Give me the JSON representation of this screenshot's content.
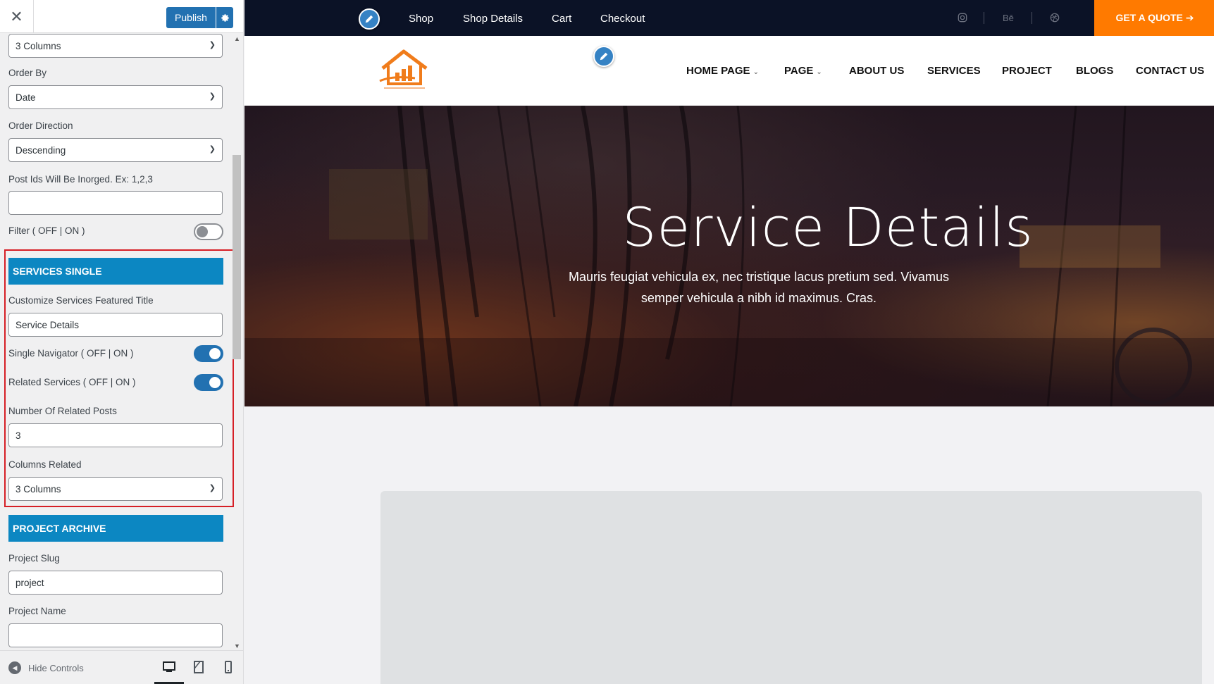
{
  "sidebar": {
    "close_icon": "close-icon",
    "publish_label": "Publish",
    "settings_icon": "gear-icon",
    "top_select_value": "3 Columns",
    "order_by": {
      "label": "Order By",
      "value": "Date"
    },
    "order_direction": {
      "label": "Order Direction",
      "value": "Descending"
    },
    "post_ids": {
      "label": "Post Ids Will Be Inorged. Ex: 1,2,3",
      "value": ""
    },
    "filter": {
      "label": "Filter ( OFF | ON )",
      "state": "off"
    },
    "services_single": {
      "heading": "SERVICES SINGLE",
      "featured_title": {
        "label": "Customize Services Featured Title",
        "value": "Service Details"
      },
      "single_navigator": {
        "label": "Single Navigator ( OFF | ON )",
        "state": "on"
      },
      "related_services": {
        "label": "Related Services ( OFF | ON )",
        "state": "on"
      },
      "related_posts": {
        "label": "Number Of Related Posts",
        "value": "3"
      },
      "columns_related": {
        "label": "Columns Related",
        "value": "3 Columns"
      }
    },
    "project_archive": {
      "heading": "PROJECT ARCHIVE",
      "project_slug": {
        "label": "Project Slug",
        "value": "project"
      },
      "project_name": {
        "label": "Project Name",
        "value": ""
      }
    },
    "footer": {
      "hide_controls_label": "Hide Controls",
      "devices": [
        "desktop-icon",
        "tablet-icon",
        "mobile-icon"
      ],
      "active_device": "desktop"
    }
  },
  "preview": {
    "topbar": {
      "links": [
        "Shop",
        "Shop Details",
        "Cart",
        "Checkout"
      ],
      "social": [
        "instagram-icon",
        "Bē",
        "dribbble-icon"
      ],
      "quote_button": "GET A QUOTE ➔"
    },
    "nav": {
      "items": [
        "HOME PAGE",
        "PAGE",
        "ABOUT US",
        "SERVICES",
        "PROJECT",
        "BLOGS",
        "CONTACT US"
      ]
    },
    "hero": {
      "title": "Service Details",
      "subtitle": "Mauris feugiat vehicula ex, nec tristique lacus pretium sed. Vivamus semper vehicula a nibh id maximus. Cras."
    }
  },
  "colors": {
    "accent": "#ff7a00",
    "section_head": "#0c87c2",
    "wp_blue": "#2271b1",
    "topbar": "#0b1226",
    "highlight": "#d61f26"
  }
}
